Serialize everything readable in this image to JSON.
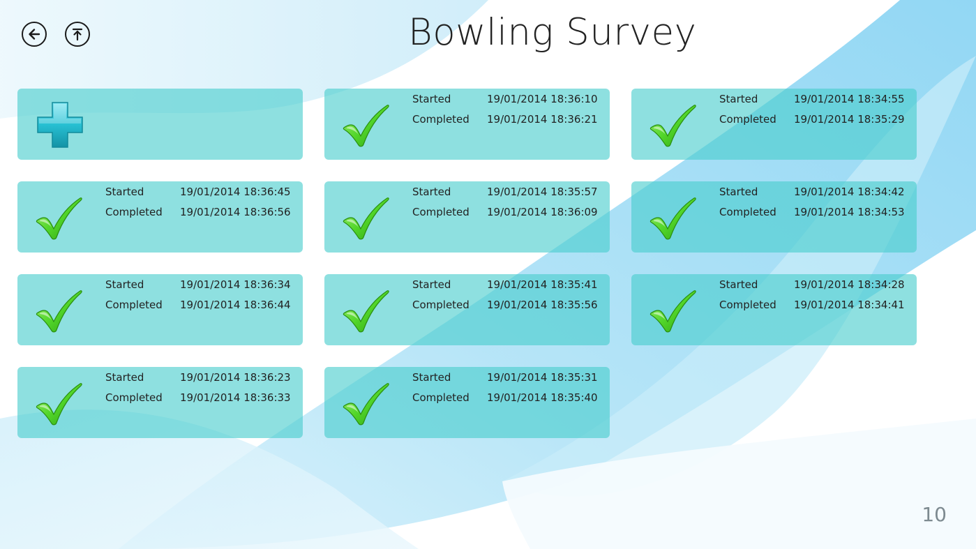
{
  "app": {
    "title": "Bowling Survey",
    "count": "10"
  },
  "nav": {
    "back_icon": "back-arrow-icon",
    "up_icon": "upload-arrow-icon"
  },
  "colors": {
    "tile": "#48cdcd",
    "check": "#52d62a",
    "plus": "#21b8c8"
  },
  "add_tile": {
    "icon": "plus-icon"
  },
  "surveys": [
    {
      "started_label": "Started",
      "started": "19/01/2014 18:36:10",
      "completed_label": "Completed",
      "completed": "19/01/2014 18:36:21"
    },
    {
      "started_label": "Started",
      "started": "19/01/2014 18:34:55",
      "completed_label": "Completed",
      "completed": "19/01/2014 18:35:29"
    },
    {
      "started_label": "Started",
      "started": "19/01/2014 18:36:45",
      "completed_label": "Completed",
      "completed": "19/01/2014 18:36:56"
    },
    {
      "started_label": "Started",
      "started": "19/01/2014 18:35:57",
      "completed_label": "Completed",
      "completed": "19/01/2014 18:36:09"
    },
    {
      "started_label": "Started",
      "started": "19/01/2014 18:34:42",
      "completed_label": "Completed",
      "completed": "19/01/2014 18:34:53"
    },
    {
      "started_label": "Started",
      "started": "19/01/2014 18:36:34",
      "completed_label": "Completed",
      "completed": "19/01/2014 18:36:44"
    },
    {
      "started_label": "Started",
      "started": "19/01/2014 18:35:41",
      "completed_label": "Completed",
      "completed": "19/01/2014 18:35:56"
    },
    {
      "started_label": "Started",
      "started": "19/01/2014 18:34:28",
      "completed_label": "Completed",
      "completed": "19/01/2014 18:34:41"
    },
    {
      "started_label": "Started",
      "started": "19/01/2014 18:36:23",
      "completed_label": "Completed",
      "completed": "19/01/2014 18:36:33"
    },
    {
      "started_label": "Started",
      "started": "19/01/2014 18:35:31",
      "completed_label": "Completed",
      "completed": "19/01/2014 18:35:40"
    }
  ]
}
